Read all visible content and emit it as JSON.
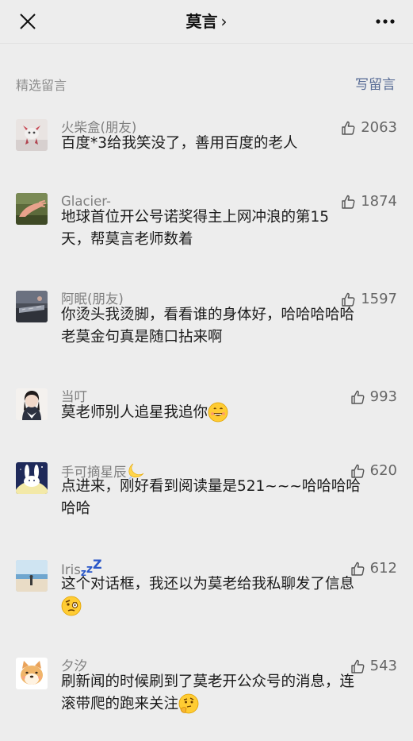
{
  "header": {
    "title": "莫言",
    "title_arrow": "›"
  },
  "section": {
    "label": "精选留言",
    "write_label": "写留言"
  },
  "comments": [
    {
      "nickname": "火柴盒(朋友)",
      "likes": "2063",
      "text": "百度*3给我笑没了，善用百度的老人"
    },
    {
      "nickname": "Glacier-",
      "likes": "1874",
      "line1": "地球首位开公号诺奖得主上网冲浪的第15",
      "line2": "天，帮莫言老师数着"
    },
    {
      "nickname": "阿眠(朋友)",
      "likes": "1597",
      "line1": "你烫头我烫脚，看看谁的身体好，哈哈哈哈哈",
      "line2": "老莫金句真是随口拈来啊"
    },
    {
      "nickname": "当叮",
      "likes": "993",
      "text": "莫老师别人追星我追你",
      "emoji": "grinning-face-emoji"
    },
    {
      "nickname": "手可摘星辰",
      "nickname_emoji": "crescent-moon-emoji",
      "likes": "620",
      "line1": "点进来，刚好看到阅读量是521~~~哈哈哈哈",
      "line2": "哈哈"
    },
    {
      "nickname": "Iris",
      "nickname_emoji": "zzz-emoji",
      "likes": "612",
      "line1": "这个对话框，我还以为莫老给我私聊发了信息",
      "emoji": "raised-eyebrow-emoji"
    },
    {
      "nickname": "夕汐",
      "likes": "543",
      "line1": "刷新闻的时候刷到了莫老开公众号的消息，连",
      "line2": "滚带爬的跑来关注",
      "emoji": "thinking-face-emoji"
    }
  ],
  "colors": {
    "background": "#ededed",
    "link": "#576b95",
    "muted": "#8e8e8e"
  }
}
